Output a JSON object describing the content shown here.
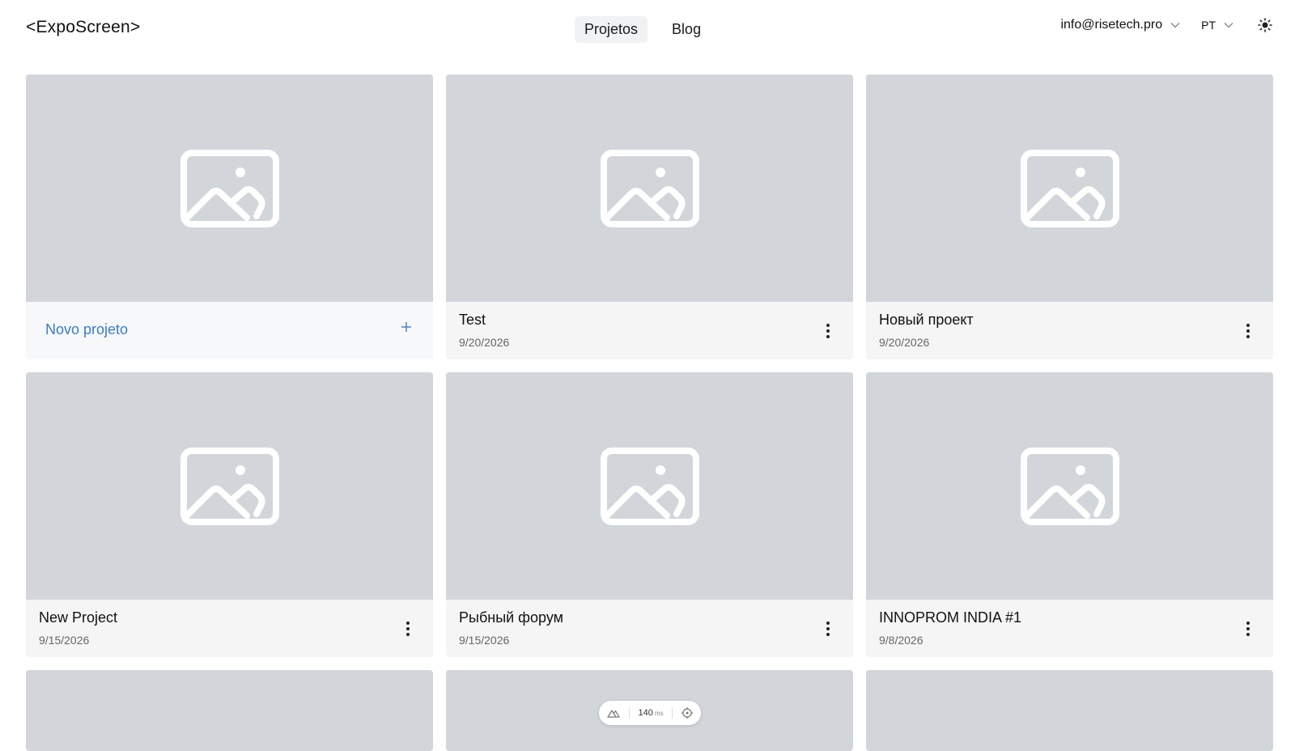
{
  "header": {
    "logo": "<ExpoScreen>",
    "nav": [
      {
        "label": "Projetos",
        "active": true
      },
      {
        "label": "Blog",
        "active": false
      }
    ],
    "account_email": "info@risetech.pro",
    "language": "PT",
    "theme_icon": "sun-icon"
  },
  "new_project": {
    "label": "Novo projeto",
    "icon": "plus-icon"
  },
  "projects": [
    {
      "title": "Test",
      "date": "9/20/2026"
    },
    {
      "title": "Новый проект",
      "date": "9/20/2026"
    },
    {
      "title": "New Project",
      "date": "9/15/2026"
    },
    {
      "title": "Рыбный форум",
      "date": "9/15/2026"
    },
    {
      "title": "INNOPROM INDIA #1",
      "date": "9/8/2026"
    }
  ],
  "perf_widget": {
    "value": "140",
    "unit": "ms"
  },
  "colors": {
    "accent": "#3a7bc8",
    "thumb_bg": "#d2d6db",
    "card_bg": "#f5f5f5"
  }
}
